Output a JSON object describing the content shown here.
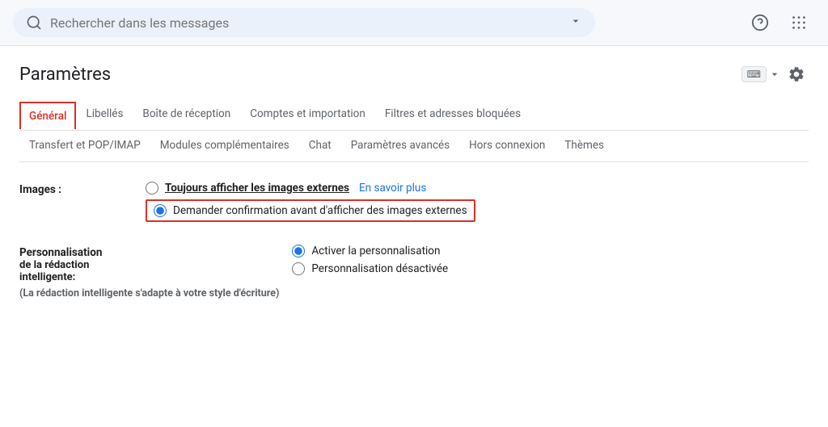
{
  "header": {
    "search_placeholder": "Rechercher dans les messages",
    "help_icon": "?",
    "apps_icon": "⠿"
  },
  "page": {
    "title": "Paramètres",
    "keyboard_label": "⌨",
    "gear_label": "⚙"
  },
  "tabs_row1": [
    {
      "id": "general",
      "label": "Général",
      "active": true
    },
    {
      "id": "libelles",
      "label": "Libellés",
      "active": false
    },
    {
      "id": "boite",
      "label": "Boîte de réception",
      "active": false
    },
    {
      "id": "comptes",
      "label": "Comptes et importation",
      "active": false
    },
    {
      "id": "filtres",
      "label": "Filtres et adresses bloquées",
      "active": false
    }
  ],
  "tabs_row2": [
    {
      "id": "transfert",
      "label": "Transfert et POP/IMAP",
      "active": false
    },
    {
      "id": "modules",
      "label": "Modules complémentaires",
      "active": false
    },
    {
      "id": "chat",
      "label": "Chat",
      "active": false
    },
    {
      "id": "avances",
      "label": "Paramètres avancés",
      "active": false
    },
    {
      "id": "hors",
      "label": "Hors connexion",
      "active": false
    },
    {
      "id": "themes",
      "label": "Thèmes",
      "active": false
    }
  ],
  "settings": {
    "images": {
      "label": "Images :",
      "option1_text": "Toujours afficher les images externes",
      "option1_link": "En savoir plus",
      "option2_text": "Demander confirmation avant d'afficher des images externes",
      "option1_selected": false,
      "option2_selected": true
    },
    "smart_compose": {
      "label1": "Personnalisation",
      "label2": "de la rédaction",
      "label3": "intelligente:",
      "option1_text": "Activer la personnalisation",
      "option2_text": "Personnalisation désactivée",
      "option1_selected": true,
      "option2_selected": false,
      "note": "(La rédaction intelligente s'adapte à votre style d'écriture)"
    }
  }
}
